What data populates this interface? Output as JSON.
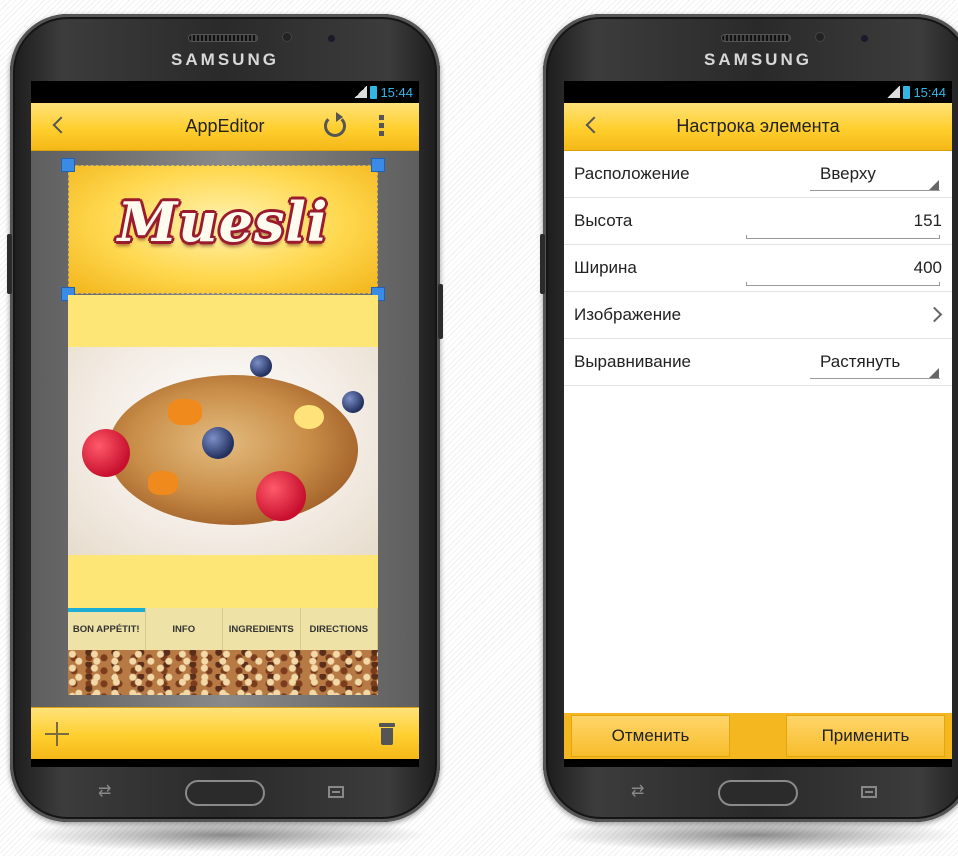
{
  "device": {
    "brand": "SAMSUNG",
    "time": "15:44"
  },
  "left_phone": {
    "app_title": "AppEditor",
    "logo_text": "Muesli",
    "tabs": [
      {
        "label": "BON APPÉTIT!"
      },
      {
        "label": "INFO"
      },
      {
        "label": "INGREDIENTS"
      },
      {
        "label": "DIRECTIONS"
      }
    ],
    "icons": {
      "back": "back-arrow-icon",
      "refresh": "refresh-icon",
      "overflow": "overflow-menu-icon",
      "add": "plus-icon",
      "delete": "trash-icon"
    }
  },
  "right_phone": {
    "title": "Настрока элемента",
    "rows": [
      {
        "label": "Расположение",
        "value": "Вверху",
        "control": "spinner"
      },
      {
        "label": "Высота",
        "value": "151",
        "control": "edit"
      },
      {
        "label": "Ширина",
        "value": "400",
        "control": "edit"
      },
      {
        "label": "Изображение",
        "value": "",
        "control": "chevron"
      },
      {
        "label": "Выравнивание",
        "value": "Растянуть",
        "control": "spinner"
      }
    ],
    "cancel_label": "Отменить",
    "apply_label": "Применить"
  },
  "colors": {
    "accent": "#ffcf2e",
    "tab_indicator": "#1eaed5",
    "status_blue": "#33b5e5"
  }
}
